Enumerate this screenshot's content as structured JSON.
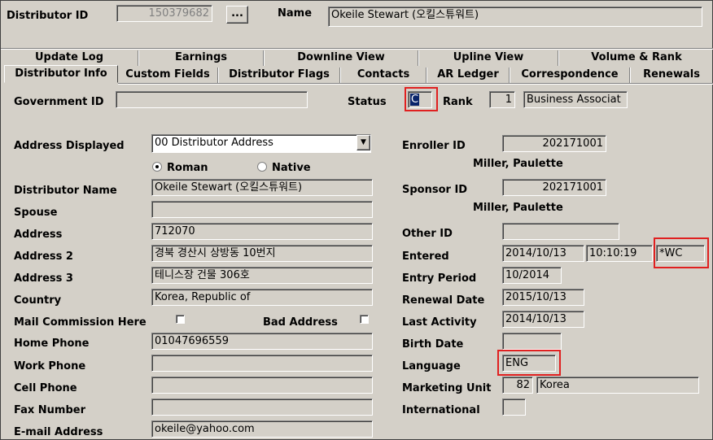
{
  "header": {
    "distributor_id_label": "Distributor ID",
    "distributor_id_value": "150379682",
    "lookup_label": "...",
    "name_label": "Name",
    "name_value": "Okeile Stewart (오킬스튜워트)"
  },
  "tabs_row1": [
    {
      "label": "Update Log"
    },
    {
      "label": "Earnings"
    },
    {
      "label": "Downline View"
    },
    {
      "label": "Upline View"
    },
    {
      "label": "Volume & Rank"
    }
  ],
  "tabs_row2": [
    {
      "label": "Distributor Info",
      "active": true
    },
    {
      "label": "Custom Fields"
    },
    {
      "label": "Distributor Flags"
    },
    {
      "label": "Contacts"
    },
    {
      "label": "AR Ledger"
    },
    {
      "label": "Correspondence"
    },
    {
      "label": "Renewals"
    }
  ],
  "top": {
    "gov_id_label": "Government ID",
    "gov_id_value": "",
    "status_label": "Status",
    "status_value": "C",
    "rank_label": "Rank",
    "rank_value": "1",
    "rank_desc": "Business Associat"
  },
  "left": {
    "address_displayed_label": "Address Displayed",
    "address_displayed_value": "00 Distributor Address",
    "roman_label": "Roman",
    "native_label": "Native",
    "distributor_name_label": "Distributor Name",
    "distributor_name_value": "Okeile Stewart (오킬스튜워트)",
    "spouse_label": "Spouse",
    "spouse_value": "",
    "address_label": "Address",
    "address_value": "712070",
    "address2_label": "Address 2",
    "address2_value": "경북 경산시 상방동 10번지",
    "address3_label": "Address 3",
    "address3_value": "테니스장 건물 306호",
    "country_label": "Country",
    "country_value": "Korea, Republic of",
    "mail_commission_label": "Mail Commission Here",
    "bad_address_label": "Bad Address",
    "home_phone_label": "Home Phone",
    "home_phone_value": "01047696559",
    "work_phone_label": "Work Phone",
    "work_phone_value": "",
    "cell_phone_label": "Cell Phone",
    "cell_phone_value": "",
    "fax_label": "Fax Number",
    "fax_value": "",
    "email_label": "E-mail Address",
    "email_value": "okeile@yahoo.com"
  },
  "right": {
    "enroller_label": "Enroller ID",
    "enroller_value": "202171001",
    "enroller_name": "Miller, Paulette",
    "sponsor_label": "Sponsor ID",
    "sponsor_value": "202171001",
    "sponsor_name": "Miller, Paulette",
    "other_id_label": "Other ID",
    "other_id_value": "",
    "entered_label": "Entered",
    "entered_date": "2014/10/13",
    "entered_time": "10:10:19",
    "entered_code": "*WC",
    "entry_period_label": "Entry Period",
    "entry_period_value": "10/2014",
    "renewal_label": "Renewal Date",
    "renewal_value": "2015/10/13",
    "last_activity_label": "Last Activity",
    "last_activity_value": "2014/10/13",
    "birth_label": "Birth Date",
    "birth_value": "",
    "language_label": "Language",
    "language_value": "ENG",
    "marketing_label": "Marketing Unit",
    "marketing_code": "82",
    "marketing_name": "Korea",
    "international_label": "International",
    "international_value": ""
  },
  "colors": {
    "highlight_red": "#e02020",
    "selection_blue": "#0a246a"
  }
}
